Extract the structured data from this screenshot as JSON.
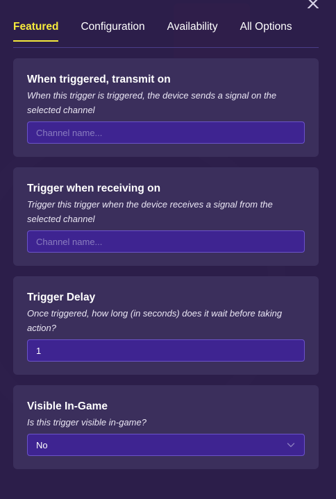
{
  "tabs": [
    {
      "label": "Featured"
    },
    {
      "label": "Configuration"
    },
    {
      "label": "Availability"
    },
    {
      "label": "All Options"
    }
  ],
  "close_icon": "close-icon",
  "sections": {
    "transmit": {
      "title": "When triggered, transmit on",
      "description": "When this trigger is triggered, the device sends a signal on the selected channel",
      "placeholder": "Channel name...",
      "value": ""
    },
    "receive": {
      "title": "Trigger when receiving on",
      "description": "Trigger this trigger when the device receives a signal from the selected channel",
      "placeholder": "Channel name...",
      "value": ""
    },
    "delay": {
      "title": "Trigger Delay",
      "description": "Once triggered, how long (in seconds) does it wait before taking action?",
      "value": "1"
    },
    "visible": {
      "title": "Visible In-Game",
      "description": "Is this trigger visible in-game?",
      "selected": "No",
      "icon": "chevron-down-icon"
    }
  },
  "colors": {
    "accent": "#f6ea3c",
    "card": "#3b2f5c",
    "field": "#3e2491"
  }
}
